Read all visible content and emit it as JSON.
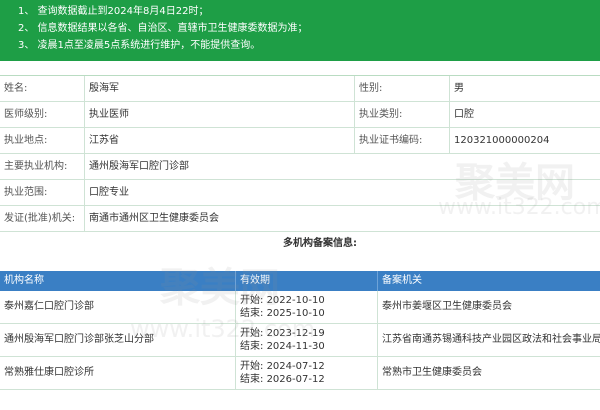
{
  "notice": {
    "lines": [
      "1、 查询数据截止到2024年8月4日22时；",
      "2、 信息数据结果以各省、自治区、直辖市卫生健康委数据为准；",
      "3、 凌晨1点至凌晨5点系统进行维护，不能提供查询。"
    ]
  },
  "info": {
    "name_label": "姓名:",
    "name_value": "殷海军",
    "gender_label": "性别:",
    "gender_value": "男",
    "level_label": "医师级别:",
    "level_value": "执业医师",
    "category_label": "执业类别:",
    "category_value": "口腔",
    "location_label": "执业地点:",
    "location_value": "江苏省",
    "cert_label": "执业证书编码:",
    "cert_value": "120321000000204",
    "org_label": "主要执业机构:",
    "org_value": "通州殷海军口腔门诊部",
    "scope_label": "执业范围:",
    "scope_value": "口腔专业",
    "issuer_label": "发证(批准)机关:",
    "issuer_value": "南通市通州区卫生健康委员会"
  },
  "multi_title": "多机构备案信息:",
  "table": {
    "headers": [
      "机构名称",
      "有效期",
      "备案机关"
    ],
    "start_prefix": "开始:",
    "end_prefix": "结束:",
    "rows": [
      {
        "name": "泰州嘉仁口腔门诊部",
        "start": "2022-10-10",
        "end": "2025-10-10",
        "org": "泰州市姜堰区卫生健康委员会"
      },
      {
        "name": "通州殷海军口腔门诊部张芝山分部",
        "start": "2023-12-19",
        "end": "2024-11-30",
        "org": "江苏省南通苏锡通科技产业园区政法和社会事业局"
      },
      {
        "name": "常熟雅仕康口腔诊所",
        "start": "2024-07-12",
        "end": "2026-07-12",
        "org": "常熟市卫生健康委员会"
      }
    ]
  },
  "watermark": {
    "brand": "聚美网",
    "url": "www.it322.com"
  }
}
